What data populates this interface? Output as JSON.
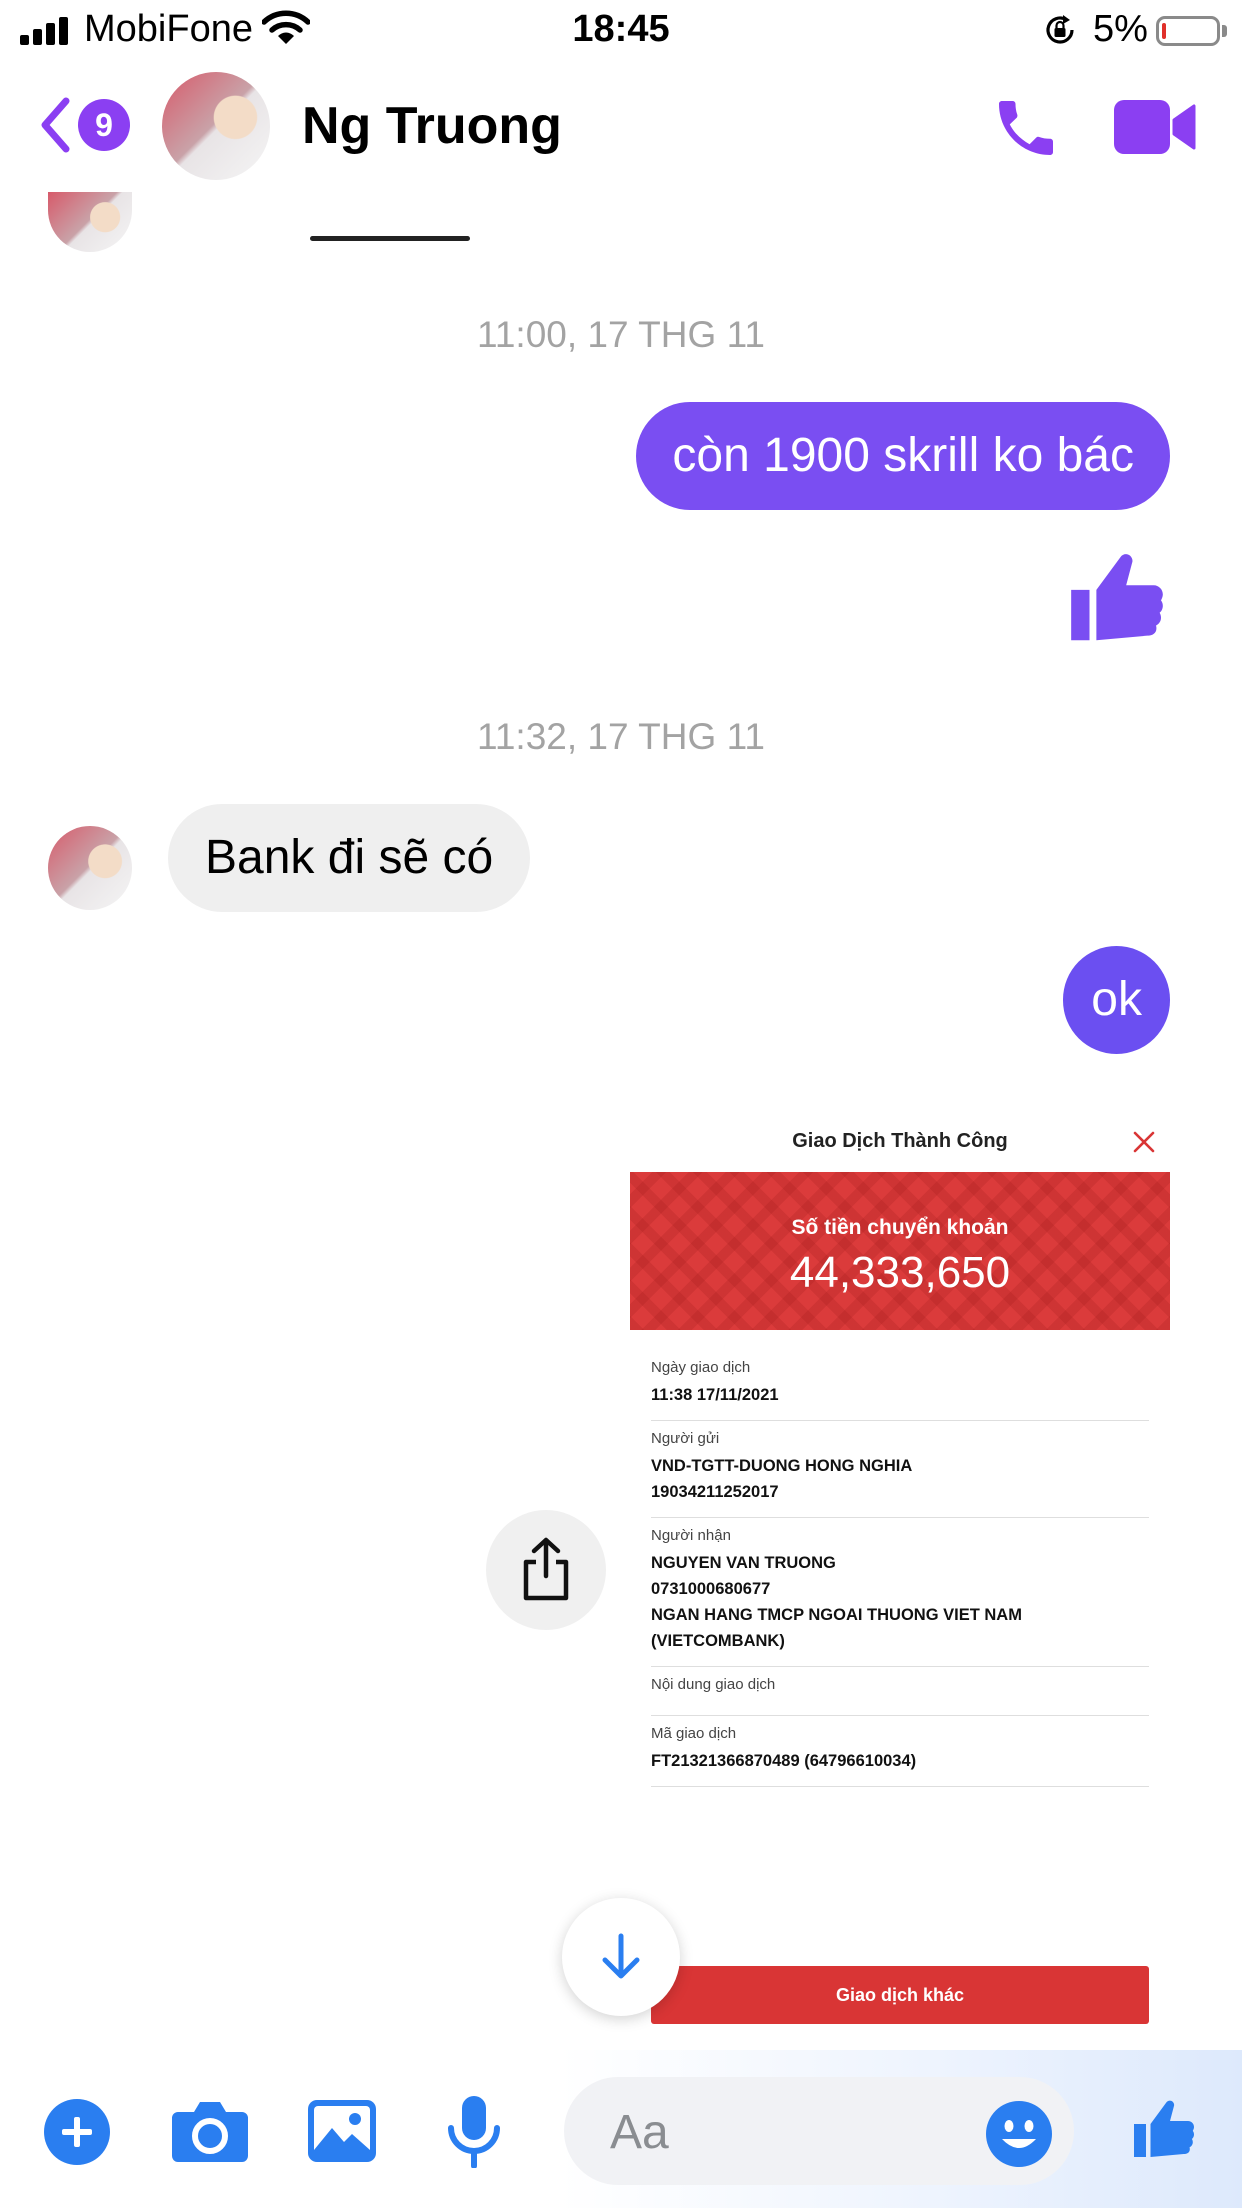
{
  "status_bar": {
    "carrier": "MobiFone",
    "time": "18:45",
    "battery_percent": "5%"
  },
  "header": {
    "unread_count": "9",
    "contact_name": "Ng Truong"
  },
  "messages": {
    "timestamp_1": "11:00, 17 THG 11",
    "out_1": "còn 1900 skrill ko bác",
    "timestamp_2": "11:32, 17 THG 11",
    "in_1": "Bank đi sẽ có",
    "out_2": "ok"
  },
  "receipt": {
    "title": "Giao Dịch Thành Công",
    "banner_label": "Số tiền chuyển khoản",
    "amount": "44,333,650",
    "rows": [
      {
        "label": "Ngày giao dịch",
        "lines": [
          "11:38 17/11/2021"
        ]
      },
      {
        "label": "Người gửi",
        "lines": [
          "VND-TGTT-DUONG HONG NGHIA",
          "19034211252017"
        ]
      },
      {
        "label": "Người nhận",
        "lines": [
          "NGUYEN VAN TRUONG",
          "0731000680677",
          "NGAN HANG TMCP NGOAI THUONG VIET NAM",
          "(VIETCOMBANK)"
        ]
      },
      {
        "label": "Nội dung giao dịch",
        "lines": []
      },
      {
        "label": "Mã giao dịch",
        "lines": [
          "FT21321366870489 (64796610034)"
        ]
      }
    ],
    "button_label": "Giao dịch khác"
  },
  "composer": {
    "placeholder": "Aa"
  },
  "colors": {
    "messenger_purple": "#8b3ff2",
    "messenger_blue": "#2a7ef0",
    "receipt_red": "#d93535"
  }
}
